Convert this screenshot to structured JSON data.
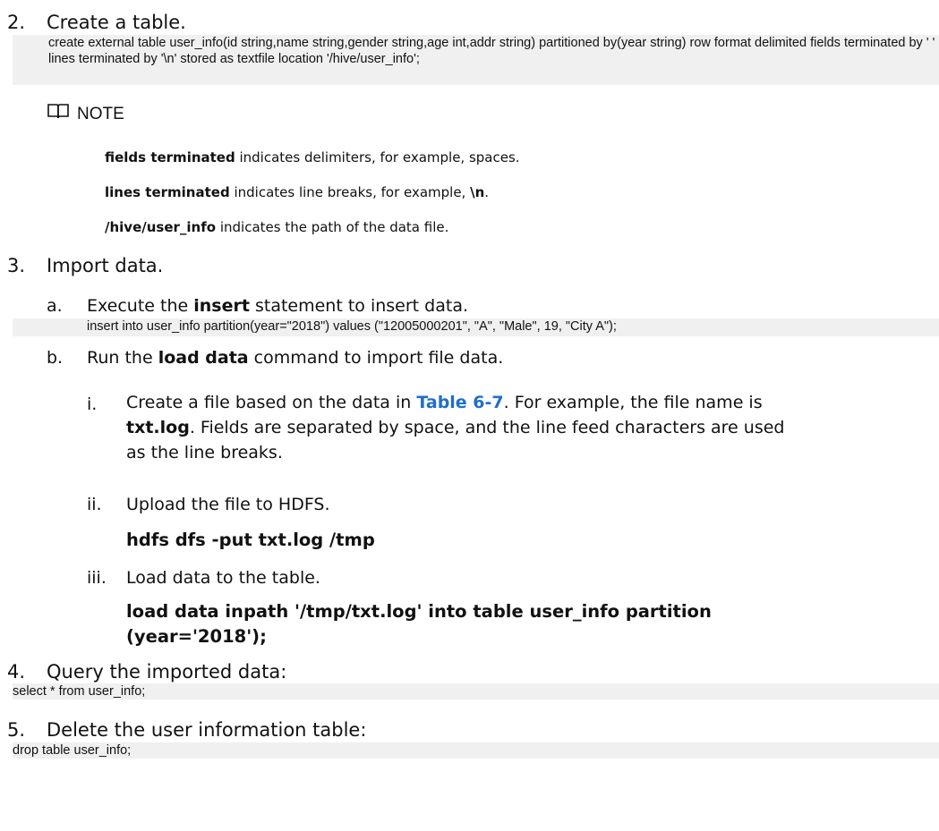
{
  "step2": {
    "num": "2.",
    "text": "Create a table.",
    "code": "create external table user_info(id string,name string,gender string,age int,addr string) partitioned by(year string) row format delimited fields terminated by ' ' lines terminated by '\\n' stored as textfile location '/hive/user_info';"
  },
  "note": {
    "title": "NOTE",
    "icon": "book-icon",
    "lines": [
      {
        "bold": "fields terminated",
        "rest": " indicates delimiters, for example, spaces."
      },
      {
        "bold": "lines terminated",
        "rest": " indicates line breaks, for example, ",
        "bold2": "\\n",
        "rest2": "."
      },
      {
        "bold": "/hive/user_info",
        "rest": " indicates the path of the data file."
      }
    ]
  },
  "step3": {
    "num": "3.",
    "text": "Import data.",
    "a": {
      "letter": "a.",
      "pre": "Execute the ",
      "bold": "insert",
      "post": " statement to insert data.",
      "code": "insert into user_info partition(year=\"2018\") values (\"12005000201\", \"A\", \"Male\", 19, \"City A\");"
    },
    "b": {
      "letter": "b.",
      "pre": "Run the ",
      "bold": "load data",
      "post": " command to import file data.",
      "i": {
        "num": "i.",
        "pre": "Create a file based on the data in ",
        "link": "Table 6-7",
        "mid": ". For example, the file name is ",
        "bold": "txt.log",
        "post": ". Fields are separated by space, and the line feed characters are used as the line breaks."
      },
      "ii": {
        "num": "ii.",
        "text": "Upload the file to HDFS.",
        "cmd": "hdfs dfs -put txt.log /tmp"
      },
      "iii": {
        "num": "iii.",
        "text": "Load data to the table.",
        "cmd": "load data inpath '/tmp/txt.log' into table user_info partition (year='2018');"
      }
    }
  },
  "step4": {
    "num": "4.",
    "text": "Query the imported data:",
    "code": "select * from user_info;"
  },
  "step5": {
    "num": "5.",
    "text": "Delete the user information table:",
    "code": "drop table user_info;"
  }
}
